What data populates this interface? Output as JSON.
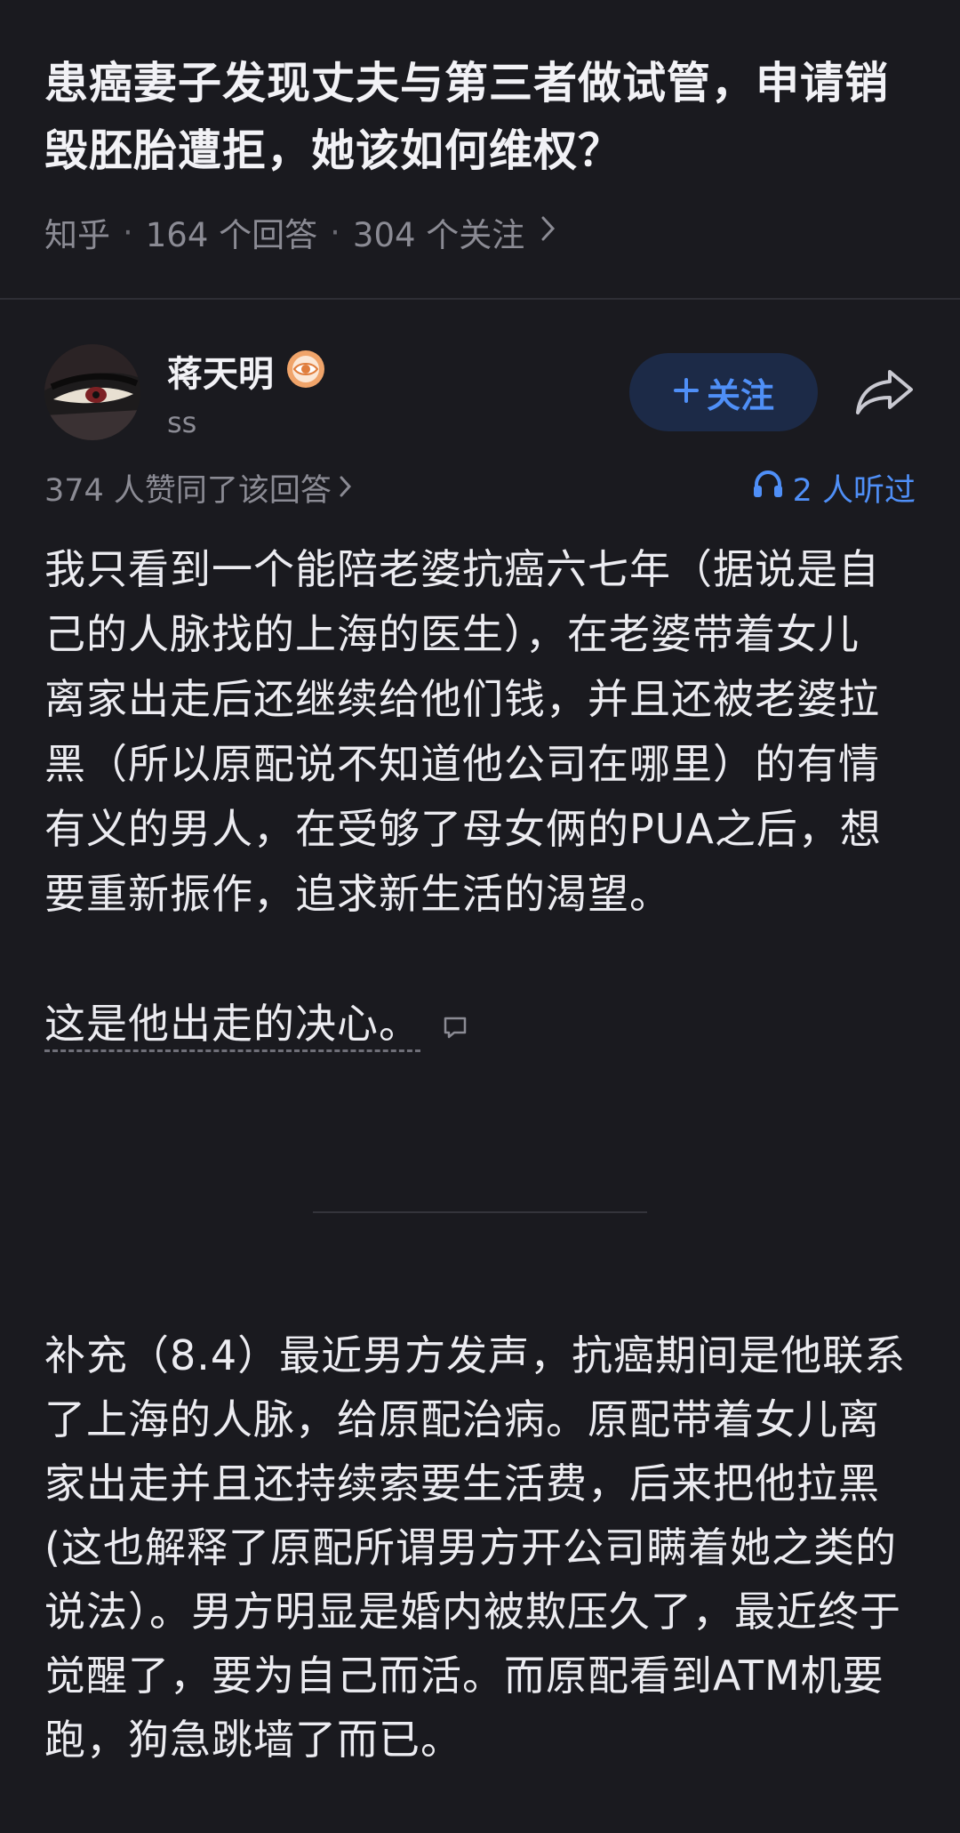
{
  "question": {
    "title": "患癌妻子发现丈夫与第三者做试管，申请销毁胚胎遭拒，她该如何维权？",
    "source": "知乎",
    "answers": "164 个回答",
    "followers": "304 个关注"
  },
  "author": {
    "name": "蒋天明",
    "subtitle": "ss",
    "follow_label": "关注",
    "badge_icon": "eye-badge-icon",
    "share_icon": "share-icon"
  },
  "stats": {
    "agree_text": "374 人赞同了该回答",
    "listened_text": "2 人听过"
  },
  "answer": {
    "paragraph1": "我只看到一个能陪老婆抗癌六七年（据说是自己的人脉找的上海的医生），在老婆带着女儿离家出走后还继续给他们钱，并且还被老婆拉黑（所以原配说不知道他公司在哪里）的有情有义的男人，在受够了母女俩的PUA之后，想要重新振作，追求新生活的渴望。",
    "paragraph2": "这是他出走的决心。",
    "supplement": "补充（8.4）最近男方发声，抗癌期间是他联系了上海的人脉，给原配治病。原配带着女儿离家出走并且还持续索要生活费，后来把他拉黑(这也解释了原配所谓男方开公司瞒着她之类的说法）。男方明显是婚内被欺压久了，最近终于觉醒了，要为自己而活。而原配看到ATM机要跑，狗急跳墙了而已。"
  },
  "colors": {
    "background": "#1a1a1f",
    "accent": "#4f8ff7",
    "follow_bg": "#1c2a47",
    "muted": "#8b8b94",
    "badge": "#f0a46a"
  }
}
